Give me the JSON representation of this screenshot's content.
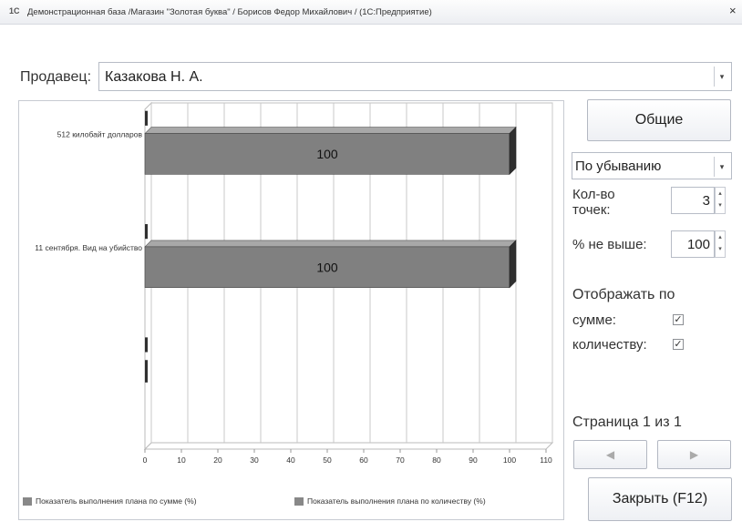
{
  "window": {
    "title": "Демонстрационная база /Магазин \"Золотая буква\" / Борисов Федор Михайлович / (1С:Предприятие)",
    "logo": "1С",
    "close": "×"
  },
  "seller": {
    "label": "Продавец:",
    "value": "Казакова Н. А.",
    "dropdown": "▾"
  },
  "buttons": {
    "general": "Общие",
    "close": "Закрыть  (F12)",
    "prev": "◀",
    "next": "▶"
  },
  "sort": {
    "value": "По убыванию",
    "dropdown": "▾"
  },
  "points": {
    "label": "Кол-во точек:",
    "value": "3"
  },
  "percent": {
    "label": "% не выше:",
    "value": "100"
  },
  "display": {
    "title": "Отображать по",
    "by_sum": {
      "label": "сумме:",
      "checked": true
    },
    "by_qty": {
      "label": "количеству:",
      "checked": true
    }
  },
  "pagination": {
    "text": "Страница 1 из 1"
  },
  "chart_data": {
    "type": "bar",
    "orientation": "horizontal",
    "categories": [
      "512 килобайт долларов",
      "11 сентября. Вид на убийство",
      ""
    ],
    "series": [
      {
        "name": "Показатель выполнения плана по сумме (%)",
        "values": [
          0,
          0,
          0
        ],
        "color": "#808080"
      },
      {
        "name": "Показатель выполнения плана по количеству (%)",
        "values": [
          100,
          100,
          0
        ],
        "color": "#808080"
      }
    ],
    "data_labels": [
      "100",
      "100",
      ""
    ],
    "x_ticks": [
      "0",
      "10",
      "20",
      "30",
      "40",
      "50",
      "60",
      "70",
      "80",
      "90",
      "100",
      "110"
    ],
    "xlim": [
      0,
      110
    ],
    "grid": true,
    "legend_position": "bottom"
  }
}
